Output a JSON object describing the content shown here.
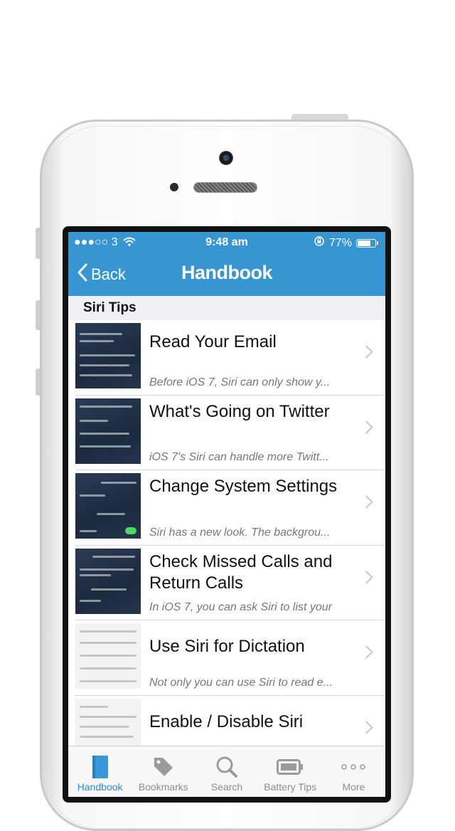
{
  "status_bar": {
    "carrier": "●●●○○ 3",
    "time": "9:48 am",
    "battery_percent": "77%",
    "battery_level": 0.77
  },
  "nav": {
    "back_label": "Back",
    "title": "Handbook"
  },
  "section": {
    "title": "Siri Tips"
  },
  "rows": [
    {
      "title": "Read Your Email",
      "subtitle": "Before iOS 7, Siri can only show y..."
    },
    {
      "title": "What's Going on Twitter",
      "subtitle": "iOS 7's Siri can handle more Twitt..."
    },
    {
      "title": "Change System Settings",
      "subtitle": "Siri has a new look. The backgrou..."
    },
    {
      "title": "Check Missed Calls and Return Calls",
      "subtitle": "In iOS 7, you can ask Siri to list your"
    },
    {
      "title": "Use Siri for Dictation",
      "subtitle": "Not only you can use Siri to read e..."
    },
    {
      "title": "Enable / Disable Siri",
      "subtitle": ""
    }
  ],
  "tabs": [
    {
      "label": "Handbook",
      "icon": "book-icon",
      "active": true
    },
    {
      "label": "Bookmarks",
      "icon": "tag-icon",
      "active": false
    },
    {
      "label": "Search",
      "icon": "search-icon",
      "active": false
    },
    {
      "label": "Battery Tips",
      "icon": "battery-icon",
      "active": false
    },
    {
      "label": "More",
      "icon": "more-icon",
      "active": false
    }
  ],
  "colors": {
    "accent": "#3796d1",
    "active_tab": "#2f8ad0"
  }
}
